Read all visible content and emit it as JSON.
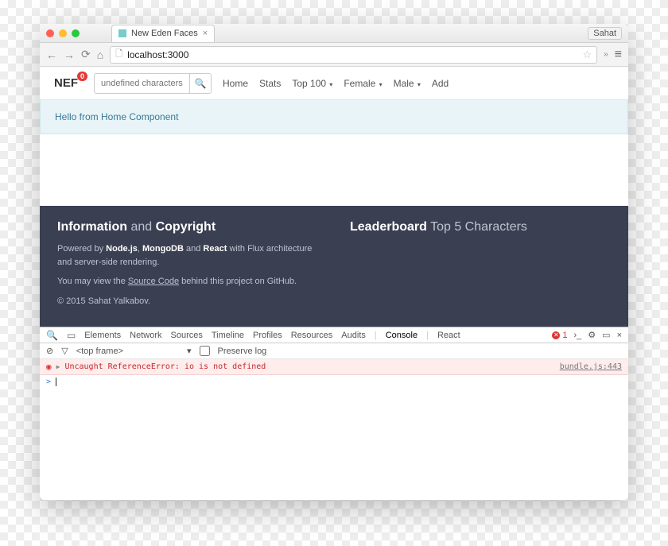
{
  "browser": {
    "tab_title": "New Eden Faces",
    "profile_label": "Sahat",
    "url": "localhost:3000"
  },
  "nav": {
    "brand": "NEF",
    "badge": "0",
    "search_placeholder": "undefined characters",
    "links": {
      "home": "Home",
      "stats": "Stats",
      "top100": "Top 100",
      "female": "Female",
      "male": "Male",
      "add": "Add"
    }
  },
  "banner": {
    "text": "Hello from Home Component"
  },
  "footer": {
    "info_title_strong": "Information",
    "info_title_and": " and ",
    "info_title_copy": "Copyright",
    "powered_prefix": "Powered by ",
    "powered_node": "Node.js",
    "powered_sep1": ", ",
    "powered_mongo": "MongoDB",
    "powered_sep2": " and ",
    "powered_react": "React",
    "powered_suffix": " with Flux architecture and server-side rendering.",
    "source_prefix": "You may view the ",
    "source_link": "Source Code",
    "source_suffix": " behind this project on GitHub.",
    "copyright": "© 2015 Sahat Yalkabov.",
    "leaderboard_strong": "Leaderboard",
    "leaderboard_rest": " Top 5 Characters"
  },
  "devtools": {
    "tabs": {
      "elements": "Elements",
      "network": "Network",
      "sources": "Sources",
      "timeline": "Timeline",
      "profiles": "Profiles",
      "resources": "Resources",
      "audits": "Audits",
      "console": "Console",
      "react": "React"
    },
    "error_count": "1",
    "frame_selector": "<top frame>",
    "preserve_log": "Preserve log",
    "error_message": "Uncaught ReferenceError: io is not defined",
    "error_source": "bundle.js:443",
    "prompt": ">"
  }
}
